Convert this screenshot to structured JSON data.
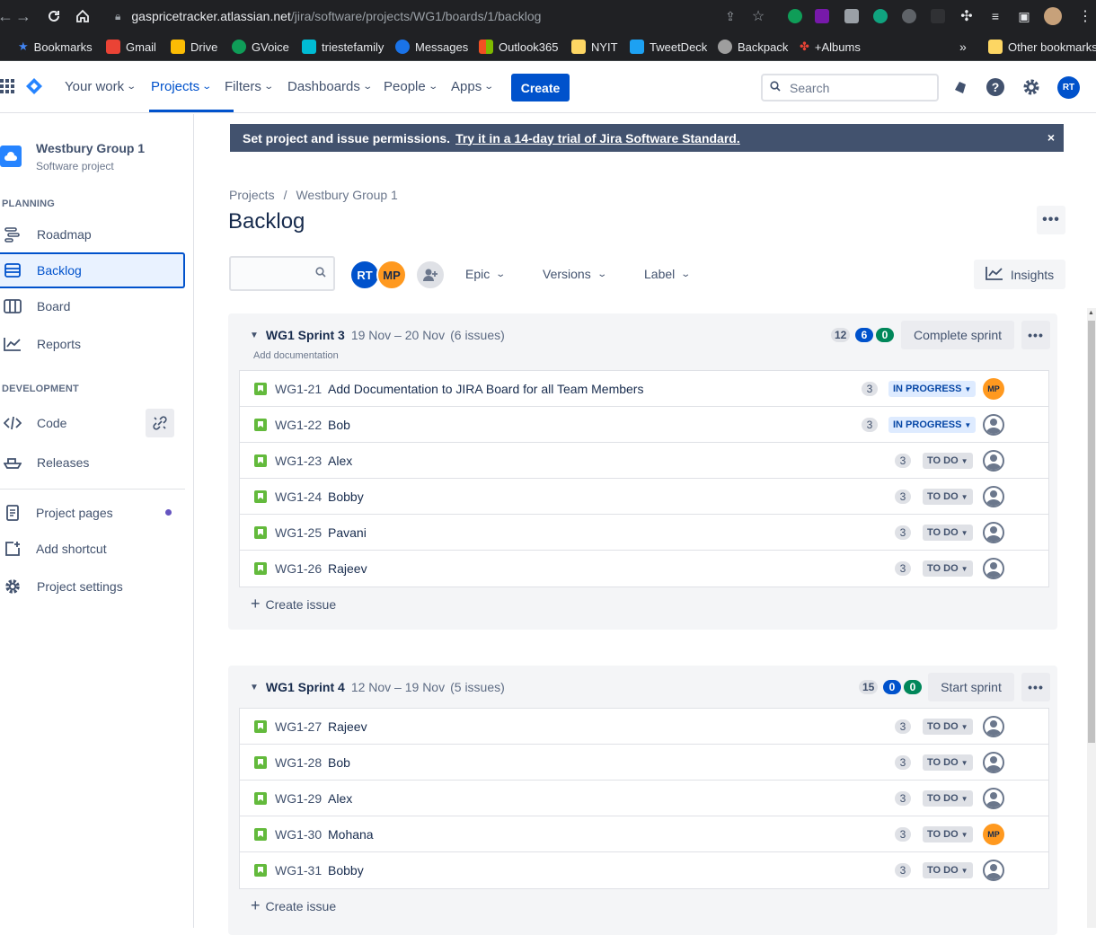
{
  "browser": {
    "url_host": "gaspricetracker.atlassian.net",
    "url_path": "/jira/software/projects/WG1/boards/1/backlog",
    "bookmarks": [
      "Bookmarks",
      "Gmail",
      "Drive",
      "GVoice",
      "triestefamily",
      "Messages",
      "Outlook365",
      "NYIT",
      "TweetDeck",
      "Backpack",
      "+Albums"
    ],
    "more_bookmarks": "»",
    "other_bookmarks": "Other bookmarks"
  },
  "header": {
    "nav": [
      "Your work",
      "Projects",
      "Filters",
      "Dashboards",
      "People",
      "Apps"
    ],
    "create_label": "Create",
    "search_placeholder": "Search",
    "avatar_initials": "RT"
  },
  "sidebar": {
    "project_name": "Westbury Group 1",
    "project_type": "Software project",
    "planning_heading": "PLANNING",
    "planning_items": [
      "Roadmap",
      "Backlog",
      "Board",
      "Reports"
    ],
    "development_heading": "DEVELOPMENT",
    "development_items": [
      "Code",
      "Releases"
    ],
    "footer_items": [
      "Project pages",
      "Add shortcut",
      "Project settings"
    ]
  },
  "banner": {
    "text": "Set project and issue permissions.",
    "link": "Try it in a 14-day trial of Jira Software Standard.",
    "close": "×"
  },
  "breadcrumb": {
    "root": "Projects",
    "separator": "/",
    "project": "Westbury Group 1"
  },
  "page_title": "Backlog",
  "filters": {
    "avatars": [
      "RT",
      "MP"
    ],
    "dropdowns": [
      "Epic",
      "Versions",
      "Label"
    ],
    "insights_label": "Insights"
  },
  "colors": {
    "accent": "#0052CC",
    "mp_avatar": "#FF991F",
    "story": "#63BA3C"
  },
  "sprints": [
    {
      "name": "WG1 Sprint 3",
      "dates": "19 Nov – 20 Nov",
      "count": "(6 issues)",
      "pills": [
        "12",
        "6",
        "0"
      ],
      "action": "Complete sprint",
      "goal": "Add documentation",
      "issues": [
        {
          "key": "WG1-21",
          "summary": "Add Documentation to JIRA Board for all Team Members",
          "points": "3",
          "status": "IN PROGRESS",
          "assignee": "MP"
        },
        {
          "key": "WG1-22",
          "summary": "Bob",
          "points": "3",
          "status": "IN PROGRESS",
          "assignee": ""
        },
        {
          "key": "WG1-23",
          "summary": "Alex",
          "points": "3",
          "status": "TO DO",
          "assignee": ""
        },
        {
          "key": "WG1-24",
          "summary": "Bobby",
          "points": "3",
          "status": "TO DO",
          "assignee": ""
        },
        {
          "key": "WG1-25",
          "summary": "Pavani",
          "points": "3",
          "status": "TO DO",
          "assignee": ""
        },
        {
          "key": "WG1-26",
          "summary": "Rajeev",
          "points": "3",
          "status": "TO DO",
          "assignee": ""
        }
      ],
      "create_issue": "Create issue"
    },
    {
      "name": "WG1 Sprint 4",
      "dates": "12 Nov – 19 Nov",
      "count": "(5 issues)",
      "pills": [
        "15",
        "0",
        "0"
      ],
      "action": "Start sprint",
      "issues": [
        {
          "key": "WG1-27",
          "summary": "Rajeev",
          "points": "3",
          "status": "TO DO",
          "assignee": ""
        },
        {
          "key": "WG1-28",
          "summary": "Bob",
          "points": "3",
          "status": "TO DO",
          "assignee": ""
        },
        {
          "key": "WG1-29",
          "summary": "Alex",
          "points": "3",
          "status": "TO DO",
          "assignee": ""
        },
        {
          "key": "WG1-30",
          "summary": "Mohana",
          "points": "3",
          "status": "TO DO",
          "assignee": "MP"
        },
        {
          "key": "WG1-31",
          "summary": "Bobby",
          "points": "3",
          "status": "TO DO",
          "assignee": ""
        }
      ],
      "create_issue": "Create issue"
    }
  ]
}
